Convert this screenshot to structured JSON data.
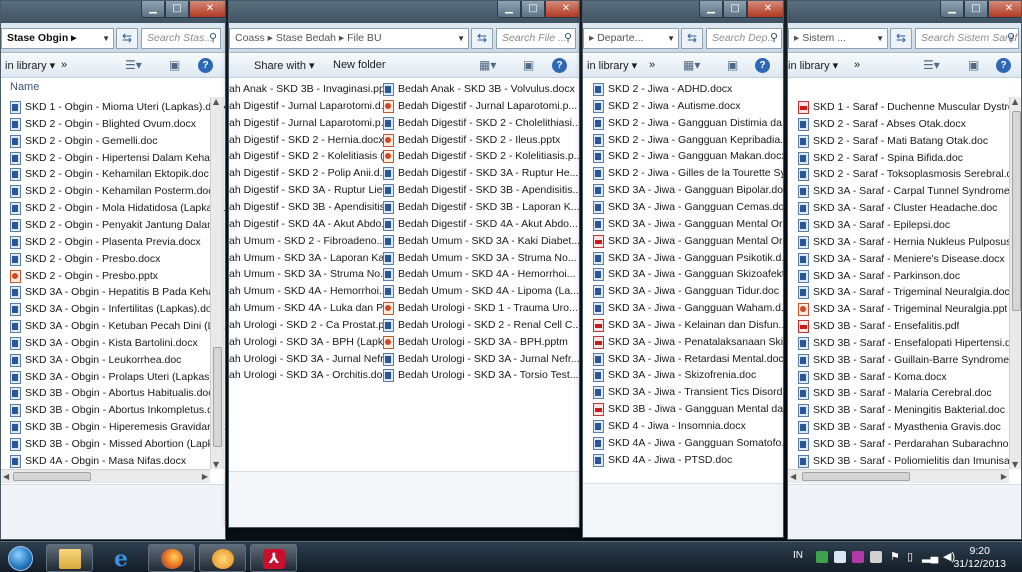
{
  "windows": [
    {
      "address": "Stase Obgin",
      "search_placeholder": "Search Stas...",
      "toolbar": {
        "library_label": "in library",
        "more": "»"
      },
      "column_header": "Name",
      "files": [
        {
          "name": "SKD 1 - Obgin - Mioma Uteri (Lapkas).docx",
          "type": "doc"
        },
        {
          "name": "SKD 2 - Obgin - Blighted Ovum.docx",
          "type": "doc"
        },
        {
          "name": "SKD 2 - Obgin - Gemelli.doc",
          "type": "doc"
        },
        {
          "name": "SKD 2 - Obgin - Hipertensi Dalam Keham...",
          "type": "doc"
        },
        {
          "name": "SKD 2 - Obgin - Kehamilan Ektopik.doc",
          "type": "doc"
        },
        {
          "name": "SKD 2 - Obgin - Kehamilan Posterm.docx",
          "type": "doc"
        },
        {
          "name": "SKD 2 - Obgin - Mola Hidatidosa (Lapkas...",
          "type": "doc"
        },
        {
          "name": "SKD 2 - Obgin - Penyakit Jantung Dalam ...",
          "type": "doc"
        },
        {
          "name": "SKD 2 - Obgin - Plasenta Previa.docx",
          "type": "doc"
        },
        {
          "name": "SKD 2 - Obgin - Presbo.docx",
          "type": "doc"
        },
        {
          "name": "SKD 2 - Obgin - Presbo.pptx",
          "type": "ppt"
        },
        {
          "name": "SKD 3A - Obgin - Hepatitis B Pada Keha...",
          "type": "doc"
        },
        {
          "name": "SKD 3A - Obgin - Infertilitas (Lapkas).docx",
          "type": "doc"
        },
        {
          "name": "SKD 3A - Obgin - Ketuban Pecah Dini (La...",
          "type": "doc"
        },
        {
          "name": "SKD 3A - Obgin - Kista Bartolini.docx",
          "type": "doc"
        },
        {
          "name": "SKD 3A - Obgin - Leukorrhea.doc",
          "type": "doc"
        },
        {
          "name": "SKD 3A - Obgin - Prolaps Uteri (Lapkas).d...",
          "type": "doc"
        },
        {
          "name": "SKD 3B - Obgin - Abortus Habitualis.doc",
          "type": "doc"
        },
        {
          "name": "SKD 3B - Obgin - Abortus Inkompletus.d...",
          "type": "doc"
        },
        {
          "name": "SKD 3B - Obgin - Hiperemesis Gravidaru...",
          "type": "doc"
        },
        {
          "name": "SKD 3B - Obgin - Missed Abortion (Lapka...",
          "type": "doc"
        },
        {
          "name": "SKD 4A - Obgin - Masa Nifas.docx",
          "type": "doc"
        }
      ]
    },
    {
      "address": "Coass  ▸  Stase Bedah  ▸  File BU",
      "search_placeholder": "Search File ...",
      "toolbar": {
        "share_label": "Share with",
        "new_folder_label": "New folder"
      },
      "files_col1": [
        "ah Anak - SKD 3B - Invaginasi.ppt",
        "ah Digestif - Jurnal Laparotomi.d...",
        "ah Digestif - Jurnal Laparotomi.p...",
        "ah Digestif - SKD 2 - Hernia.docx",
        "ah Digestif - SKD 2 - Kolelitiasis (...",
        "ah Digestif - SKD 2 - Polip Anii.d...",
        "ah Digestif - SKD 3A - Ruptur Lie...",
        "ah Digestif - SKD 3B - Apendisitis...",
        "ah Digestif - SKD 4A - Akut Abdo...",
        "ah Umum - SKD 2 - Fibroadeno...",
        "ah Umum - SKD 3A - Laporan Ka...",
        "ah Umum - SKD 3A - Struma No...",
        "ah Umum - SKD 4A - Hemorrhoi...",
        "ah Umum - SKD 4A - Luka dan P...",
        "ah Urologi - SKD 2 - Ca Prostat.ppt",
        "ah Urologi - SKD 3A - BPH (Lapk...",
        "ah Urologi - SKD 3A - Jurnal Nefr...",
        "ah Urologi - SKD 3A - Orchitis.do..."
      ],
      "files_col2": [
        {
          "name": "Bedah Anak - SKD 3B - Volvulus.docx",
          "type": "doc"
        },
        {
          "name": "Bedah Digestif - Jurnal Laparotomi.p...",
          "type": "ppt"
        },
        {
          "name": "Bedah Digestif - SKD 2 - Cholelithiasi...",
          "type": "doc"
        },
        {
          "name": "Bedah Digestif - SKD 2 - Ileus.pptx",
          "type": "ppt"
        },
        {
          "name": "Bedah Digestif - SKD 2 - Kolelitiasis.p...",
          "type": "ppt"
        },
        {
          "name": "Bedah Digestif - SKD 3A - Ruptur He...",
          "type": "doc"
        },
        {
          "name": "Bedah Digestif - SKD 3B - Apendisitis...",
          "type": "doc"
        },
        {
          "name": "Bedah Digestif - SKD 3B - Laporan K...",
          "type": "doc"
        },
        {
          "name": "Bedah Digestif - SKD 4A - Akut Abdo...",
          "type": "doc"
        },
        {
          "name": "Bedah Umum - SKD 3A - Kaki Diabet...",
          "type": "doc"
        },
        {
          "name": "Bedah Umum - SKD 3A - Struma No...",
          "type": "doc"
        },
        {
          "name": "Bedah Umum - SKD 4A - Hemorrhoi...",
          "type": "doc"
        },
        {
          "name": "Bedah Umum - SKD 4A - Lipoma (La...",
          "type": "doc"
        },
        {
          "name": "Bedah Urologi - SKD 1 - Trauma Uro...",
          "type": "ppt"
        },
        {
          "name": "Bedah Urologi - SKD 2 - Renal Cell C...",
          "type": "doc"
        },
        {
          "name": "Bedah Urologi - SKD 3A - BPH.pptm",
          "type": "ppt"
        },
        {
          "name": "Bedah Urologi - SKD 3A - Jurnal Nefr...",
          "type": "doc"
        },
        {
          "name": "Bedah Urologi - SKD 3A - Torsio Test...",
          "type": "doc"
        }
      ]
    },
    {
      "address": "Departe...",
      "search_placeholder": "Search Dep...",
      "toolbar": {
        "library_label": "in library",
        "more": "»"
      },
      "files": [
        {
          "name": "SKD 2 - Jiwa - ADHD.docx",
          "type": "doc"
        },
        {
          "name": "SKD 2 - Jiwa - Autisme.docx",
          "type": "doc"
        },
        {
          "name": "SKD 2 - Jiwa - Gangguan Distimia da...",
          "type": "doc"
        },
        {
          "name": "SKD 2 - Jiwa - Gangguan Kepribadia...",
          "type": "doc"
        },
        {
          "name": "SKD 2 - Jiwa - Gangguan Makan.docx",
          "type": "doc"
        },
        {
          "name": "SKD 2 - Jiwa - Gilles de la Tourette Sy...",
          "type": "doc"
        },
        {
          "name": "SKD 3A - Jiwa - Gangguan Bipolar.doc",
          "type": "doc"
        },
        {
          "name": "SKD 3A - Jiwa - Gangguan Cemas.doc",
          "type": "doc"
        },
        {
          "name": "SKD 3A - Jiwa - Gangguan Mental Or...",
          "type": "doc"
        },
        {
          "name": "SKD 3A - Jiwa - Gangguan Mental Or...",
          "type": "pdf"
        },
        {
          "name": "SKD 3A - Jiwa - Gangguan Psikotik.d...",
          "type": "doc"
        },
        {
          "name": "SKD 3A - Jiwa - Gangguan Skizoafekt...",
          "type": "doc"
        },
        {
          "name": "SKD 3A - Jiwa - Gangguan Tidur.doc",
          "type": "doc"
        },
        {
          "name": "SKD 3A - Jiwa - Gangguan Waham.d...",
          "type": "doc"
        },
        {
          "name": "SKD 3A - Jiwa - Kelainan dan Disfun...",
          "type": "pdf"
        },
        {
          "name": "SKD 3A - Jiwa - Penatalaksanaan Skiz...",
          "type": "pdf"
        },
        {
          "name": "SKD 3A - Jiwa - Retardasi Mental.doc",
          "type": "doc"
        },
        {
          "name": "SKD 3A - Jiwa - Skizofrenia.doc",
          "type": "doc"
        },
        {
          "name": "SKD 3A - Jiwa - Transient Tics Disord...",
          "type": "doc"
        },
        {
          "name": "SKD 3B - Jiwa - Gangguan Mental da...",
          "type": "pdf"
        },
        {
          "name": "SKD 4 - Jiwa - Insomnia.docx",
          "type": "doc"
        },
        {
          "name": "SKD 4A - Jiwa - Gangguan Somatofo...",
          "type": "doc"
        },
        {
          "name": "SKD 4A - Jiwa - PTSD.doc",
          "type": "doc"
        }
      ]
    },
    {
      "address": "Sistem ...",
      "search_placeholder": "Search Sistem Saraf",
      "toolbar": {
        "library_label": "in library",
        "more": "»"
      },
      "files": [
        {
          "name": "SKD 1 - Saraf - Duchenne Muscular Dystrophy.",
          "type": "pdf"
        },
        {
          "name": "SKD 2 - Saraf - Abses Otak.docx",
          "type": "doc"
        },
        {
          "name": "SKD 2 - Saraf - Mati Batang Otak.doc",
          "type": "doc"
        },
        {
          "name": "SKD 2 - Saraf - Spina Bifida.doc",
          "type": "doc"
        },
        {
          "name": "SKD 2 - Saraf - Toksoplasmosis Serebral.docx",
          "type": "doc"
        },
        {
          "name": "SKD 3A - Saraf - Carpal Tunnel Syndrome.doc",
          "type": "doc"
        },
        {
          "name": "SKD 3A - Saraf - Cluster Headache.doc",
          "type": "doc"
        },
        {
          "name": "SKD 3A - Saraf - Epilepsi.doc",
          "type": "doc"
        },
        {
          "name": "SKD 3A - Saraf - Hernia Nukleus Pulposus.doc",
          "type": "doc"
        },
        {
          "name": "SKD 3A - Saraf - Meniere's Disease.docx",
          "type": "doc"
        },
        {
          "name": "SKD 3A - Saraf - Parkinson.doc",
          "type": "doc"
        },
        {
          "name": "SKD 3A - Saraf - Trigeminal Neuralgia.doc",
          "type": "doc"
        },
        {
          "name": "SKD 3A - Saraf - Trigeminal Neuralgia.ppt",
          "type": "ppt"
        },
        {
          "name": "SKD 3B - Saraf - Ensefalitis.pdf",
          "type": "pdf"
        },
        {
          "name": "SKD 3B - Saraf - Ensefalopati Hipertensi.doc",
          "type": "doc"
        },
        {
          "name": "SKD 3B - Saraf - Guillain-Barre Syndrome.docx",
          "type": "doc"
        },
        {
          "name": "SKD 3B - Saraf - Koma.docx",
          "type": "doc"
        },
        {
          "name": "SKD 3B - Saraf - Malaria Cerebral.doc",
          "type": "doc"
        },
        {
          "name": "SKD 3B - Saraf - Meningitis Bakterial.doc",
          "type": "doc"
        },
        {
          "name": "SKD 3B - Saraf - Myasthenia Gravis.doc",
          "type": "doc"
        },
        {
          "name": "SKD 3B - Saraf - Perdarahan Subarachnoid.doc",
          "type": "doc"
        },
        {
          "name": "SKD 3B - Saraf - Poliomielitis dan Imunisasi.doc",
          "type": "doc"
        }
      ]
    }
  ],
  "taskbar": {
    "language": "IN",
    "time": "9:20",
    "date": "31/12/2013",
    "pinned": [
      "windows-explorer-icon",
      "internet-explorer-icon",
      "firefox-icon",
      "media-player-icon",
      "acrobat-icon"
    ]
  }
}
